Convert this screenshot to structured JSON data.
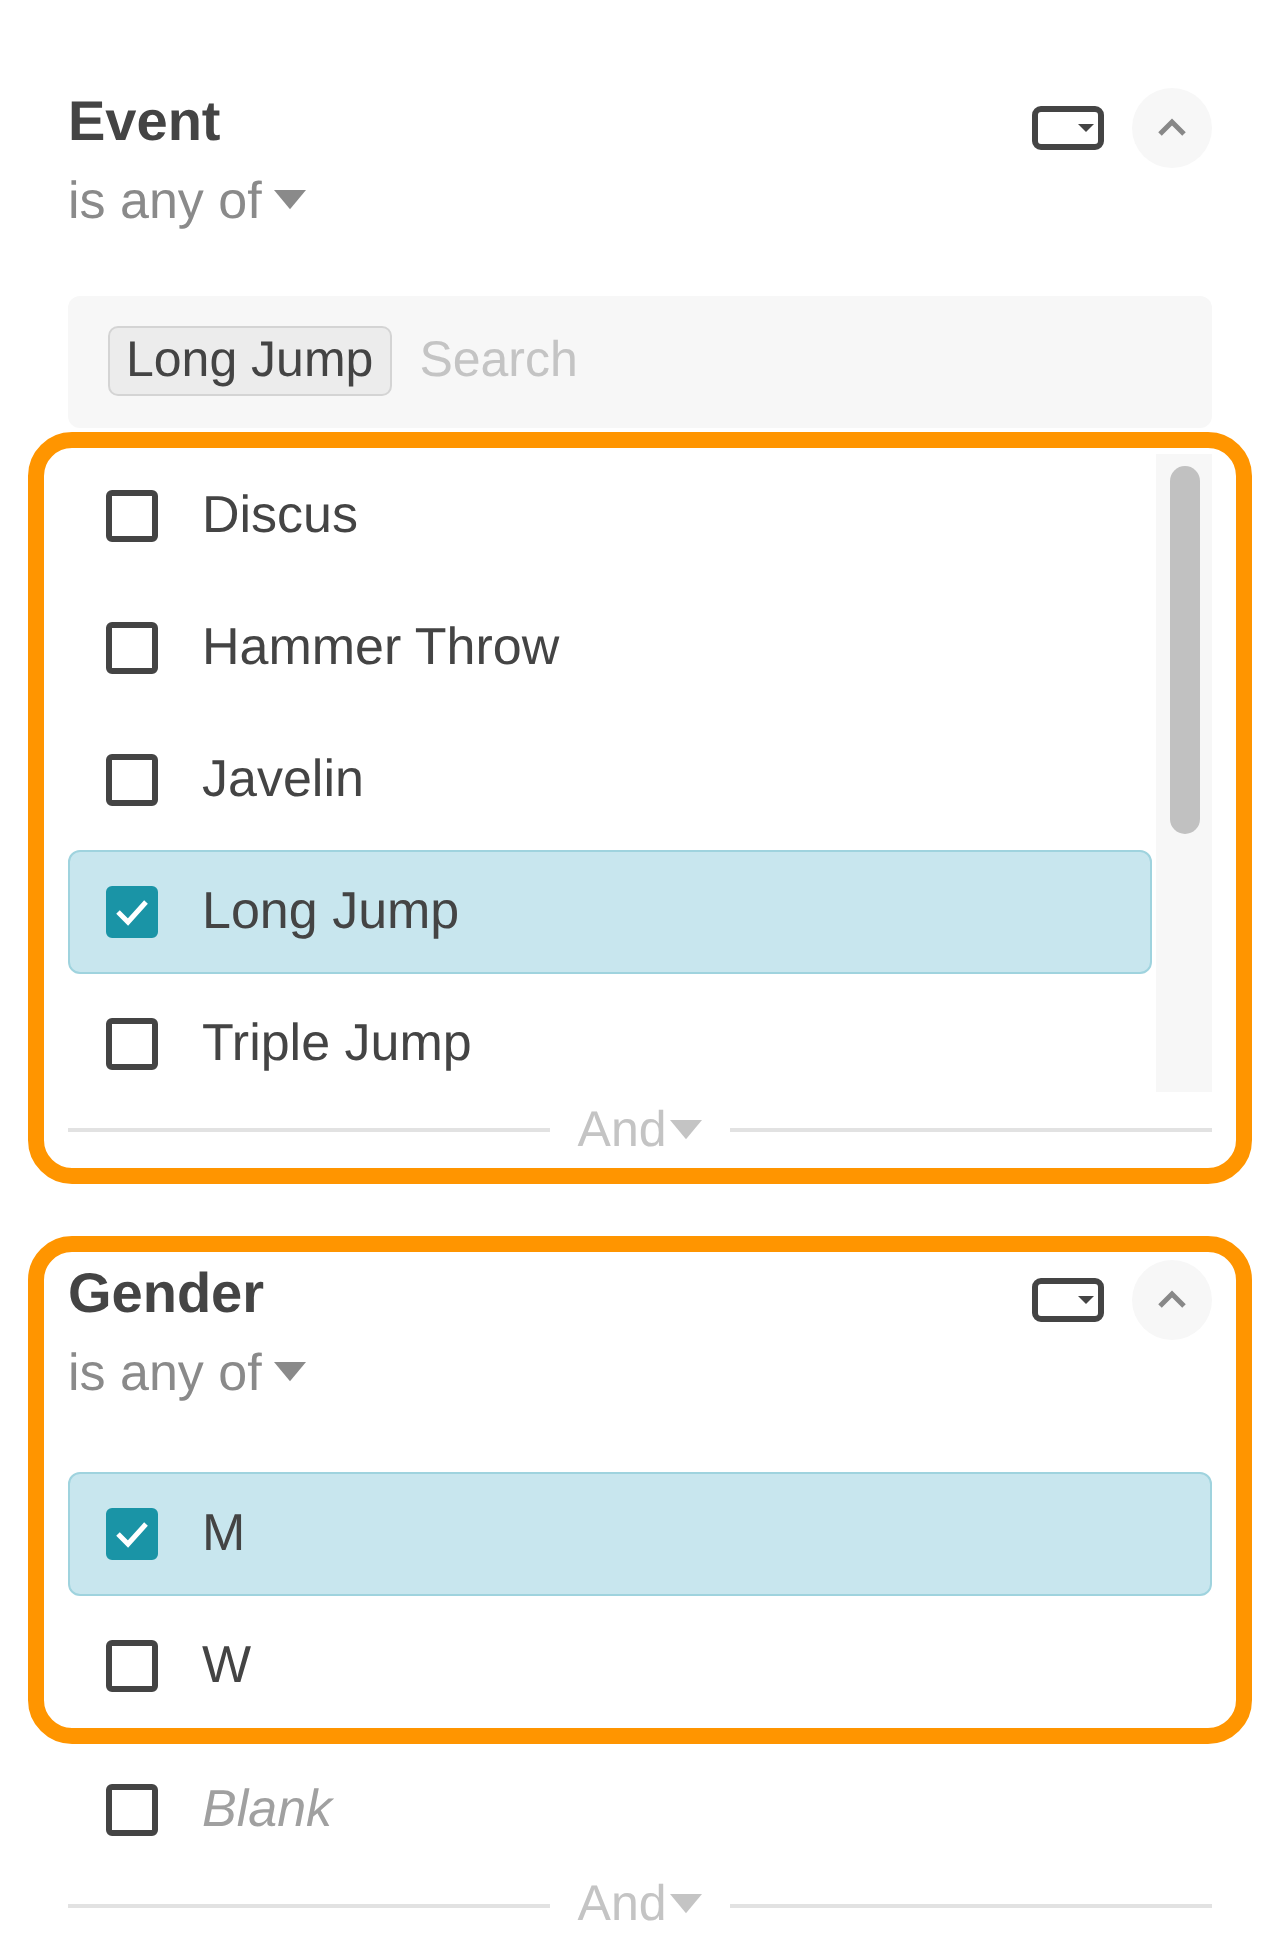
{
  "blocks": [
    {
      "kind": "header",
      "title": "Event",
      "operator": "is any of"
    },
    {
      "kind": "search",
      "chips": [
        "Long Jump"
      ],
      "placeholder": "Search"
    },
    {
      "kind": "frame",
      "children": [
        {
          "kind": "option_list",
          "options": [
            {
              "label": "Discus",
              "checked": false
            },
            {
              "label": "Hammer Throw",
              "checked": false
            },
            {
              "label": "Javelin",
              "checked": false
            },
            {
              "label": "Long Jump",
              "checked": true
            },
            {
              "label": "Triple Jump",
              "checked": false
            }
          ]
        },
        {
          "kind": "connector",
          "label": "And"
        }
      ]
    },
    {
      "kind": "frame",
      "children": [
        {
          "kind": "header",
          "title": "Gender",
          "operator": "is any of"
        },
        {
          "kind": "option",
          "label": "M",
          "checked": true
        },
        {
          "kind": "option",
          "label": "W",
          "checked": false
        }
      ]
    },
    {
      "kind": "blank_option",
      "label": "Blank",
      "checked": false
    },
    {
      "kind": "connector",
      "label": "And"
    }
  ]
}
